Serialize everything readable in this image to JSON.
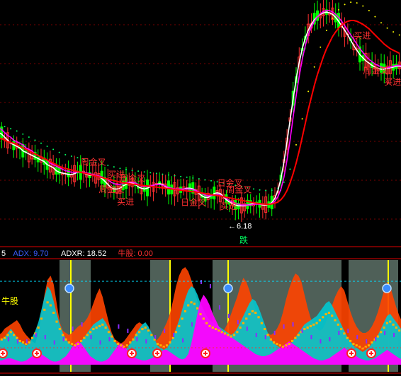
{
  "colors": {
    "background": "#000000",
    "candle_up": "#ff3030",
    "candle_down": "#00ff00",
    "candle_flat": "#ffffff",
    "ma_white": "#ffffff",
    "ma_magenta": "#ff00ff",
    "ma_red": "#ff0000",
    "dots_green": "#00ff60",
    "dots_yellow": "#ffff00",
    "signal_red": "#ff3030",
    "signal_yellow": "#ffff00",
    "panel_band": "#4f6058",
    "orange_area": "#ff4400",
    "cyan_area": "#00c8d0",
    "magenta_area": "#ff00ff",
    "steps_yellow": "#ffb000",
    "axis_red": "#e00000",
    "adx_blue": "#3a5cff"
  },
  "chart_data": [
    {
      "type": "candlestick",
      "title": "",
      "y_scale": "price",
      "grid": true,
      "annotations": [
        {
          "text": "周金叉",
          "x": 27
        },
        {
          "text": "周金叉",
          "x": 33
        },
        {
          "text": "买进",
          "x": 36
        },
        {
          "text": "买进",
          "x": 39
        },
        {
          "text": "周金叉",
          "x": 40
        },
        {
          "text": "日金叉",
          "x": 60
        },
        {
          "text": "日金叉",
          "x": 72
        },
        {
          "text": "买进",
          "x": 73
        },
        {
          "text": "周金叉",
          "x": 75
        },
        {
          "text": "周金叉",
          "x": 120
        },
        {
          "text": "买进",
          "x": 117
        },
        {
          "text": "买进",
          "x": 127
        }
      ],
      "low_marker_text": "6.18",
      "trend_tag": "跌",
      "series": [
        {
          "name": "ma_white",
          "values": [
            12.6,
            12.5,
            12.3,
            12.1,
            11.9,
            11.8,
            11.7,
            11.6,
            11.4,
            11.3,
            11.2,
            11.1,
            11.0,
            10.9,
            10.8,
            10.7,
            10.5,
            10.4,
            10.3,
            10.1,
            10.0,
            9.95,
            9.9,
            9.85,
            9.85,
            9.9,
            10.0,
            10.0,
            9.95,
            9.85,
            9.8,
            9.8,
            9.75,
            9.7,
            9.6,
            9.4,
            9.2,
            9.0,
            8.9,
            8.9,
            8.95,
            9.1,
            9.2,
            9.3,
            9.3,
            9.2,
            9.05,
            8.95,
            8.9,
            8.95,
            9.05,
            9.15,
            9.2,
            9.25,
            9.2,
            9.05,
            8.95,
            8.9,
            8.85,
            8.85,
            8.85,
            8.9,
            8.95,
            8.95,
            8.9,
            8.8,
            8.6,
            8.45,
            8.35,
            8.35,
            8.45,
            8.6,
            8.65,
            8.6,
            8.4,
            8.2,
            8.05,
            7.95,
            7.85,
            7.8,
            7.8,
            7.8,
            7.85,
            7.9,
            7.95,
            7.95,
            7.9,
            7.85,
            7.85,
            7.9,
            8.0,
            8.3,
            8.8,
            9.6,
            10.7,
            12.0,
            13.4,
            14.8,
            16.1,
            17.2,
            18.1,
            18.8,
            19.3,
            19.7,
            20.0,
            20.2,
            20.35,
            20.45,
            20.5,
            20.45,
            20.35,
            20.15,
            19.9,
            19.6,
            19.3,
            19.0,
            18.65,
            18.3,
            18.0,
            17.7,
            17.5,
            17.3,
            17.15,
            17.0,
            16.9,
            16.8,
            16.75,
            16.75,
            16.8,
            16.85,
            16.9,
            16.95,
            16.95,
            16.9
          ]
        },
        {
          "name": "ma_magenta",
          "values": [
            12.9,
            12.8,
            12.6,
            12.4,
            12.3,
            12.1,
            12.0,
            11.9,
            11.8,
            11.6,
            11.5,
            11.4,
            11.2,
            11.1,
            11.0,
            10.9,
            10.8,
            10.6,
            10.5,
            10.4,
            10.3,
            10.2,
            10.1,
            10.05,
            10.0,
            10.0,
            10.0,
            10.0,
            10.0,
            9.95,
            9.9,
            9.85,
            9.8,
            9.75,
            9.7,
            9.6,
            9.5,
            9.35,
            9.25,
            9.2,
            9.2,
            9.25,
            9.3,
            9.35,
            9.35,
            9.3,
            9.2,
            9.1,
            9.05,
            9.05,
            9.1,
            9.15,
            9.2,
            9.2,
            9.15,
            9.1,
            9.0,
            8.95,
            8.9,
            8.9,
            8.9,
            8.9,
            8.9,
            8.9,
            8.85,
            8.8,
            8.7,
            8.6,
            8.5,
            8.45,
            8.45,
            8.5,
            8.55,
            8.5,
            8.4,
            8.3,
            8.15,
            8.05,
            7.95,
            7.9,
            7.85,
            7.85,
            7.85,
            7.85,
            7.9,
            7.9,
            7.9,
            7.9,
            7.9,
            7.9,
            7.95,
            8.1,
            8.4,
            8.9,
            9.7,
            10.8,
            12.1,
            13.6,
            15.0,
            16.3,
            17.4,
            18.3,
            19.0,
            19.5,
            19.9,
            20.2,
            20.4,
            20.55,
            20.6,
            20.6,
            20.5,
            20.35,
            20.15,
            19.9,
            19.6,
            19.3,
            19.0,
            18.7,
            18.4,
            18.1,
            17.85,
            17.6,
            17.4,
            17.25,
            17.1,
            17.0,
            16.9,
            16.85,
            16.85,
            16.9,
            16.95,
            17.0,
            17.0,
            16.95
          ]
        },
        {
          "name": "ma_red",
          "values": [
            12.2,
            12.2,
            12.1,
            12.0,
            11.95,
            11.9,
            11.8,
            11.7,
            11.6,
            11.5,
            11.4,
            11.3,
            11.2,
            11.1,
            11.0,
            10.9,
            10.8,
            10.7,
            10.6,
            10.5,
            10.4,
            10.3,
            10.25,
            10.2,
            10.15,
            10.1,
            10.05,
            10.0,
            9.95,
            9.9,
            9.85,
            9.8,
            9.75,
            9.7,
            9.65,
            9.6,
            9.55,
            9.5,
            9.45,
            9.4,
            9.35,
            9.3,
            9.28,
            9.25,
            9.22,
            9.2,
            9.17,
            9.15,
            9.12,
            9.1,
            9.07,
            9.05,
            9.02,
            9.0,
            8.97,
            8.95,
            8.92,
            8.9,
            8.87,
            8.85,
            8.82,
            8.8,
            8.77,
            8.75,
            8.72,
            8.7,
            8.67,
            8.64,
            8.6,
            8.57,
            8.54,
            8.5,
            8.47,
            8.44,
            8.4,
            8.36,
            8.32,
            8.28,
            8.24,
            8.2,
            8.16,
            8.12,
            8.08,
            8.04,
            8.0,
            7.97,
            7.94,
            7.92,
            7.9,
            7.9,
            7.92,
            7.97,
            8.05,
            8.2,
            8.45,
            8.8,
            9.3,
            9.9,
            10.6,
            11.4,
            12.3,
            13.2,
            14.1,
            14.9,
            15.7,
            16.4,
            17.0,
            17.6,
            18.1,
            18.5,
            18.9,
            19.2,
            19.45,
            19.65,
            19.8,
            19.9,
            19.95,
            19.95,
            19.9,
            19.8,
            19.7,
            19.55,
            19.4,
            19.2,
            19.0,
            18.8,
            18.6,
            18.4,
            18.25,
            18.1,
            18.0,
            17.9,
            17.8
          ]
        }
      ]
    },
    {
      "type": "area",
      "title": "",
      "legend": [
        {
          "text": "5",
          "color": "#ffffff"
        },
        {
          "text": "ADX: 9.70",
          "color": "#3a5cff"
        },
        {
          "text": "ADXR: 18.52",
          "color": "#ffffff"
        },
        {
          "text": "牛股: 0.00",
          "color": "#ff3030"
        }
      ],
      "side_label": "牛股",
      "series": [
        {
          "name": "orange",
          "values": [
            28,
            30,
            34,
            36,
            38,
            40,
            42,
            38,
            32,
            28,
            25,
            22,
            20,
            30,
            48,
            66,
            80,
            84,
            76,
            58,
            40,
            32,
            30,
            28,
            30,
            33,
            36,
            38,
            40,
            44,
            50,
            58,
            66,
            72,
            64,
            52,
            40,
            30,
            24,
            22,
            20,
            22,
            26,
            30,
            34,
            38,
            40,
            38,
            34,
            30,
            26,
            22,
            24,
            28,
            34,
            40,
            48,
            60,
            74,
            84,
            90,
            92,
            88,
            80,
            70,
            60,
            50,
            44,
            40,
            36,
            32,
            30,
            28,
            30,
            34,
            40,
            48,
            56,
            64,
            74,
            82,
            78,
            70,
            60,
            52,
            46,
            40,
            34,
            30,
            28,
            30,
            34,
            40,
            50,
            62,
            72,
            80,
            86,
            84,
            78,
            66,
            54,
            44,
            38,
            34,
            32,
            34,
            40,
            48,
            56,
            64,
            70,
            74,
            70,
            60,
            50,
            42,
            36,
            32,
            30,
            30,
            32,
            36,
            42,
            50,
            60,
            70,
            78,
            74,
            64,
            54,
            46,
            40
          ]
        },
        {
          "name": "cyan",
          "values": [
            22,
            24,
            26,
            30,
            34,
            30,
            26,
            22,
            20,
            18,
            20,
            26,
            32,
            40,
            52,
            64,
            74,
            70,
            60,
            48,
            38,
            30,
            24,
            20,
            18,
            16,
            18,
            22,
            26,
            30,
            34,
            38,
            40,
            42,
            44,
            40,
            34,
            28,
            22,
            18,
            16,
            14,
            16,
            20,
            24,
            30,
            34,
            38,
            40,
            36,
            30,
            24,
            18,
            16,
            14,
            16,
            20,
            26,
            34,
            42,
            52,
            62,
            70,
            74,
            72,
            66,
            58,
            52,
            46,
            42,
            40,
            38,
            36,
            34,
            32,
            30,
            28,
            30,
            34,
            40,
            46,
            52,
            58,
            62,
            60,
            54,
            46,
            38,
            30,
            24,
            20,
            18,
            16,
            14,
            16,
            18,
            22,
            26,
            30,
            34,
            38,
            40,
            42,
            44,
            46,
            50,
            54,
            58,
            60,
            56,
            50,
            44,
            38,
            32,
            26,
            22,
            18,
            16,
            14,
            12,
            14,
            16,
            20,
            24,
            28,
            34,
            40,
            46,
            48,
            44,
            40,
            36,
            32
          ]
        },
        {
          "name": "magenta",
          "values": [
            4,
            4,
            5,
            6,
            6,
            5,
            4,
            3,
            3,
            4,
            6,
            8,
            10,
            12,
            10,
            8,
            6,
            4,
            3,
            3,
            4,
            6,
            8,
            12,
            16,
            20,
            22,
            20,
            16,
            12,
            8,
            6,
            4,
            3,
            3,
            4,
            6,
            10,
            14,
            18,
            20,
            18,
            14,
            10,
            8,
            6,
            5,
            4,
            4,
            5,
            6,
            8,
            10,
            12,
            14,
            14,
            12,
            10,
            8,
            6,
            5,
            6,
            10,
            20,
            34,
            48,
            60,
            66,
            62,
            56,
            48,
            42,
            36,
            32,
            30,
            28,
            26,
            24,
            22,
            20,
            18,
            16,
            14,
            12,
            10,
            9,
            8,
            8,
            9,
            10,
            12,
            14,
            16,
            18,
            20,
            22,
            20,
            18,
            16,
            14,
            12,
            10,
            8,
            6,
            5,
            4,
            4,
            5,
            6,
            8,
            10,
            12,
            14,
            16,
            14,
            12,
            10,
            8,
            6,
            5,
            4,
            4,
            5,
            6,
            8,
            10,
            12,
            14,
            12,
            10,
            8,
            6,
            5
          ]
        }
      ]
    }
  ]
}
